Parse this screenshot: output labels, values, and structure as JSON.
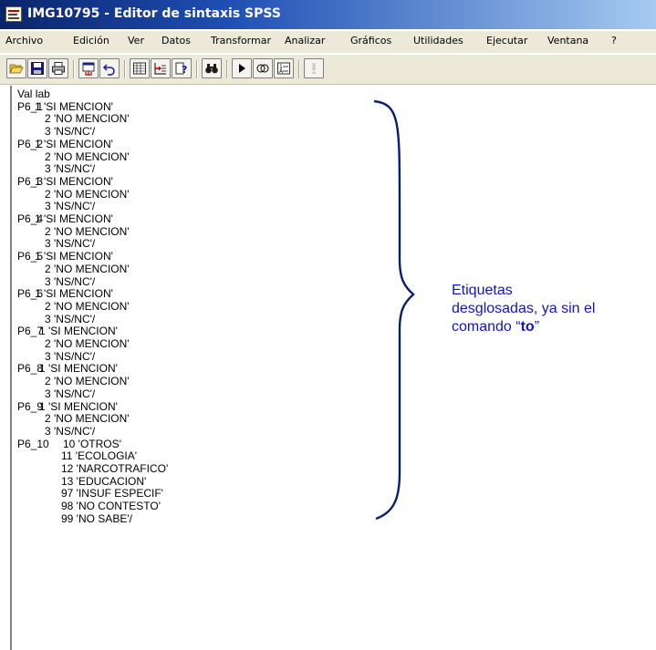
{
  "window": {
    "title": "IMG10795 - Editor de sintaxis SPSS",
    "icon": "spss-syntax-icon"
  },
  "menu": [
    "Archivo",
    "Edición",
    "Ver",
    "Datos",
    "Transformar",
    "Analizar",
    "Gráficos",
    "Utilidades",
    "Ejecutar",
    "Ventana",
    "?"
  ],
  "toolbar": {
    "buttons": [
      "open-folder-icon",
      "save-disk-icon",
      "print-icon",
      "dialog-recall-icon",
      "undo-icon",
      "data-table-icon",
      "goto-case-icon",
      "variables-icon",
      "find-binoculars-icon",
      "run-icon",
      "use-sets-icon",
      "value-labels-icon",
      "designate-window-icon"
    ]
  },
  "syntax": {
    "command": "Val lab",
    "blocks": [
      {
        "var": "P6_1",
        "lines": [
          "1 'SI MENCION'",
          "2 'NO MENCION'",
          "3 'NS/NC'/"
        ]
      },
      {
        "var": "P6_2",
        "lines": [
          "1 'SI MENCION'",
          "2 'NO MENCION'",
          "3 'NS/NC'/"
        ]
      },
      {
        "var": "P6_3",
        "lines": [
          "1 'SI MENCION'",
          "2 'NO MENCION'",
          "3 'NS/NC'/"
        ]
      },
      {
        "var": "P6_4",
        "lines": [
          "1 'SI MENCION'",
          "2 'NO MENCION'",
          "3 'NS/NC'/"
        ]
      },
      {
        "var": "P6_5",
        "lines": [
          "1 'SI MENCION'",
          "2 'NO MENCION'",
          "3 'NS/NC'/"
        ]
      },
      {
        "var": "P6_6",
        "lines": [
          "1 'SI MENCION'",
          "2 'NO MENCION'",
          "3 'NS/NC'/"
        ]
      },
      {
        "var": "P6_7",
        "lines": [
          "1 'SI MENCION'",
          "2 'NO MENCION'",
          "3 'NS/NC'/"
        ]
      },
      {
        "var": "P6_8",
        "lines": [
          "1 'SI MENCION'",
          "2 'NO MENCION'",
          "3 'NS/NC'/"
        ]
      },
      {
        "var": "P6_9",
        "lines": [
          "1 'SI MENCION'",
          "2 'NO MENCION'",
          "3 'NS/NC'/"
        ]
      },
      {
        "var": "P6_10",
        "lines": [
          "10 'OTROS'",
          "11 'ECOLOGIA'",
          "12 'NARCOTRAFICO'",
          "13 'EDUCACION'",
          "97 'INSUF ESPECIF'",
          "98 'NO CONTESTO'",
          "99 'NO SABE'/"
        ]
      }
    ]
  },
  "annotation": {
    "line1": "Etiquetas",
    "line2": "desglosadas, ya sin el",
    "line3_prefix": "comando “",
    "line3_keyword": "to",
    "line3_suffix": "”",
    "color": "#1313c8",
    "brace_color": "#0a1e6e"
  }
}
